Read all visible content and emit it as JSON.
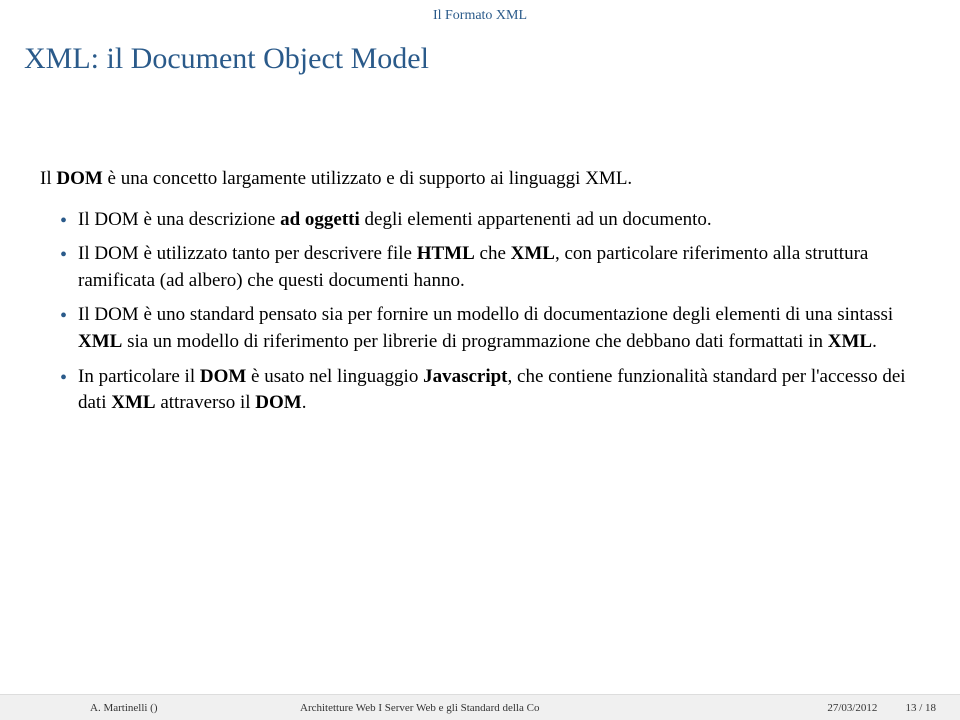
{
  "breadcrumb": "Il Formato XML",
  "title": "XML: il Document Object Model",
  "intro_pre": "Il ",
  "intro_bold": "DOM",
  "intro_post": " è una concetto largamente utilizzato e di supporto ai linguaggi XML.",
  "bullets": [
    {
      "parts": [
        {
          "t": "Il DOM è una descrizione "
        },
        {
          "t": "ad oggetti",
          "b": true
        },
        {
          "t": " degli elementi appartenenti ad un documento."
        }
      ]
    },
    {
      "parts": [
        {
          "t": "Il DOM è utilizzato tanto per descrivere file "
        },
        {
          "t": "HTML",
          "b": true
        },
        {
          "t": " che "
        },
        {
          "t": "XML",
          "b": true
        },
        {
          "t": ", con particolare riferimento alla struttura ramificata (ad albero) che questi documenti hanno."
        }
      ]
    },
    {
      "parts": [
        {
          "t": "Il DOM è uno standard pensato sia per fornire un modello di documentazione degli elementi di una sintassi "
        },
        {
          "t": "XML",
          "b": true
        },
        {
          "t": " sia un modello di riferimento per librerie di programmazione che debbano dati formattati in "
        },
        {
          "t": "XML",
          "b": true
        },
        {
          "t": "."
        }
      ]
    },
    {
      "parts": [
        {
          "t": "In particolare il "
        },
        {
          "t": "DOM",
          "b": true
        },
        {
          "t": " è usato nel linguaggio "
        },
        {
          "t": "Javascript",
          "b": true
        },
        {
          "t": ", che contiene funzionalità standard per l'accesso dei dati "
        },
        {
          "t": "XML",
          "b": true
        },
        {
          "t": " attraverso il "
        },
        {
          "t": "DOM",
          "b": true
        },
        {
          "t": "."
        }
      ]
    }
  ],
  "footer": {
    "author": "A. Martinelli ()",
    "title": "Architetture Web  I Server Web e gli Standard della Co",
    "date": "27/03/2012",
    "page": "13 / 18"
  }
}
